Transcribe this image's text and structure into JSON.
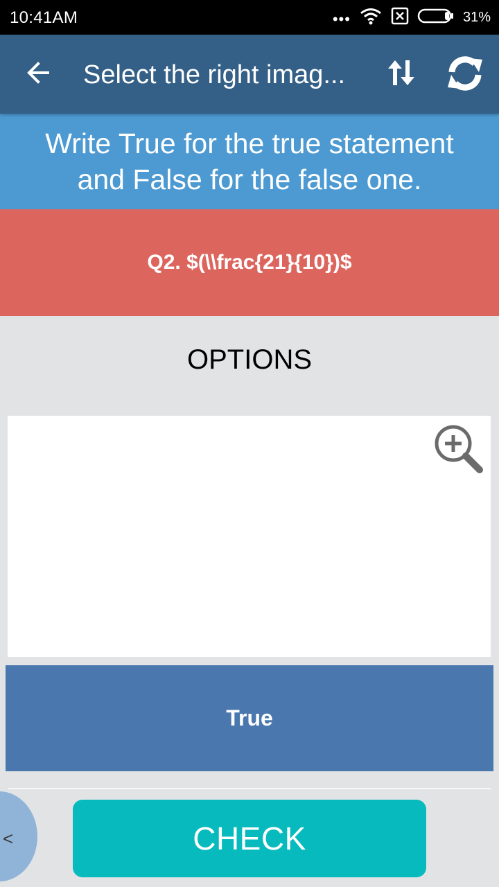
{
  "status_bar": {
    "time": "10:41AM",
    "dots": "•••",
    "battery": "31%"
  },
  "app_bar": {
    "title": "Select the right imag...",
    "back_icon": "arrow-left-icon",
    "sort_icon": "sort-arrows-icon",
    "refresh_icon": "refresh-icon"
  },
  "instruction": "Write True for the true statement and False for the false one.",
  "question": "Q2. $(\\\\frac{21}{10})$",
  "options_heading": "OPTIONS",
  "option_answer": "True",
  "check_label": "CHECK",
  "side_tab_glyph": "<",
  "colors": {
    "app_bar": "#345f86",
    "instruction_bg": "#4d9ad2",
    "question_bg": "#dc665e",
    "option_bg": "#4a77ae",
    "check_bg": "#07babd",
    "page_bg": "#e2e3e5"
  }
}
